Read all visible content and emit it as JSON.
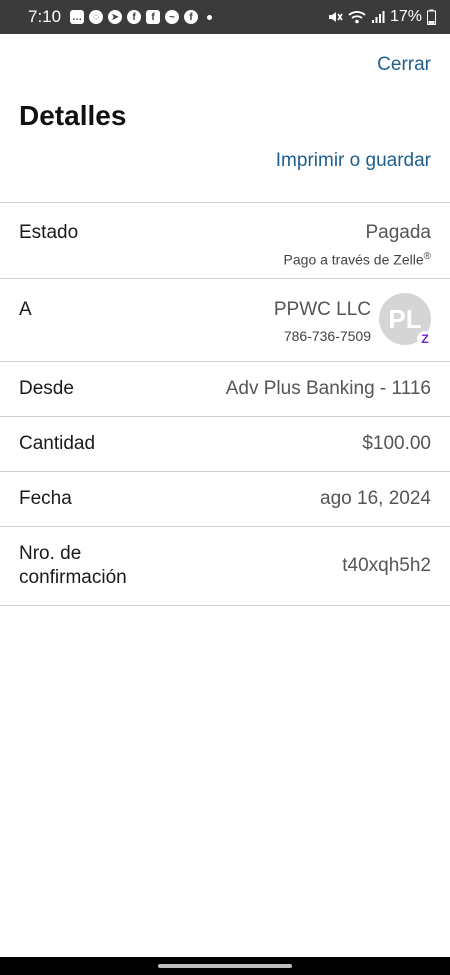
{
  "status_bar": {
    "time": "7:10",
    "battery": "17%",
    "notification_icons": [
      "chat-icon",
      "whatsapp-icon",
      "telegram-icon",
      "facebook-icon",
      "facebook-icon",
      "messenger-icon",
      "facebook-icon"
    ]
  },
  "header": {
    "close_label": "Cerrar",
    "title": "Detalles",
    "print_label": "Imprimir o guardar"
  },
  "details": {
    "estado": {
      "label": "Estado",
      "value": "Pagada",
      "sub": "Pago a través de Zelle",
      "sub_mark": "®"
    },
    "a": {
      "label": "A",
      "name": "PPWC LLC",
      "phone": "786-736-7509",
      "avatar_initials": "PL",
      "badge_icon": "zelle-icon",
      "badge_glyph": "Z"
    },
    "desde": {
      "label": "Desde",
      "value": "Adv Plus Banking - 1116"
    },
    "cantidad": {
      "label": "Cantidad",
      "value": "$100.00"
    },
    "fecha": {
      "label": "Fecha",
      "value": "ago 16, 2024"
    },
    "confirmacion": {
      "label": "Nro. de confirmación",
      "value": "t40xqh5h2"
    }
  },
  "colors": {
    "link": "#1f5f8e",
    "status_bar": "#3b3b3b",
    "zelle_purple": "#6d1ed4"
  }
}
